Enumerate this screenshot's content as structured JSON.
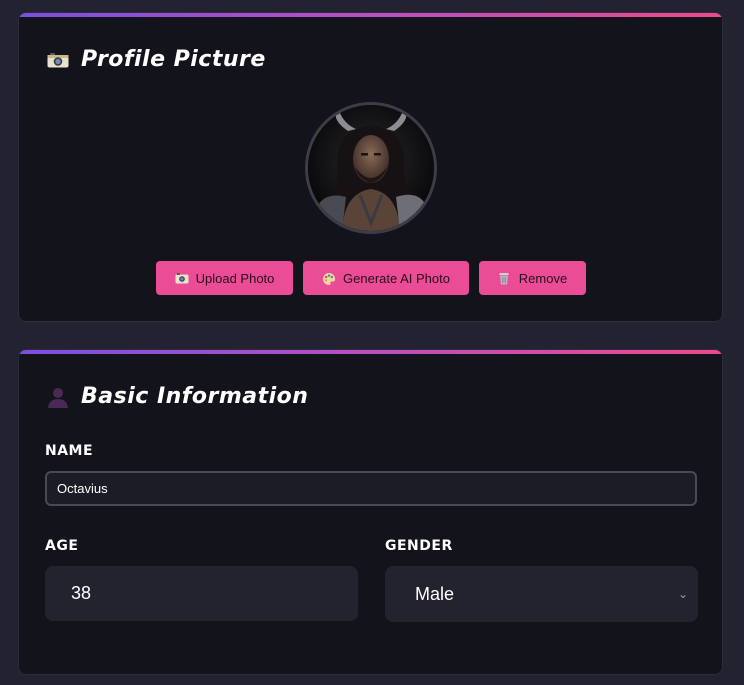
{
  "profile_picture": {
    "title": "Profile Picture",
    "icon": "camera-icon",
    "buttons": {
      "upload": {
        "label": "Upload Photo",
        "icon": "camera-icon"
      },
      "generate": {
        "label": "Generate AI Photo",
        "icon": "palette-icon"
      },
      "remove": {
        "label": "Remove",
        "icon": "trash-icon"
      }
    }
  },
  "basic_information": {
    "title": "Basic Information",
    "icon": "person-icon",
    "name": {
      "label": "NAME",
      "value": "Octavius"
    },
    "age": {
      "label": "AGE",
      "value": "38"
    },
    "gender": {
      "label": "GENDER",
      "value": "Male"
    }
  },
  "colors": {
    "accent_pink": "#ea4c96",
    "accent_purple": "#7a4fe0",
    "card_bg": "#13131c",
    "page_bg": "#222230"
  }
}
